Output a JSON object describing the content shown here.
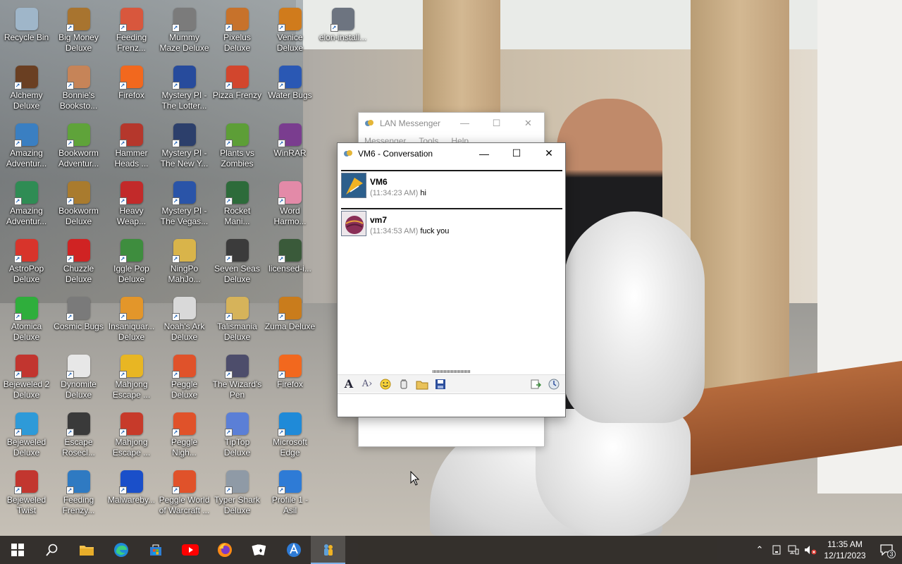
{
  "desktop": {
    "icons": [
      {
        "label": "Recycle Bin",
        "icon": "recycle-bin-icon",
        "color": "#9fb6c9"
      },
      {
        "label": "Big Money\nDeluxe",
        "icon": "money-bag-icon",
        "color": "#a8742f"
      },
      {
        "label": "Feeding\nFrenz...",
        "icon": "fish-icon",
        "color": "#d8573d"
      },
      {
        "label": "Mummy\nMaze Deluxe",
        "icon": "mummy-icon",
        "color": "#7b7b7b"
      },
      {
        "label": "Pixelus\nDeluxe",
        "icon": "pixelus-icon",
        "color": "#c7722b"
      },
      {
        "label": "Venice\nDeluxe",
        "icon": "venice-icon",
        "color": "#d07b1c"
      },
      {
        "label": "elon-install...",
        "icon": "installer-icon",
        "color": "#6d7480"
      },
      {
        "label": "Alchemy\nDeluxe",
        "icon": "alchemy-icon",
        "color": "#6a3f22"
      },
      {
        "label": "Bonnie's\nBooksto...",
        "icon": "bonnie-icon",
        "color": "#c68458"
      },
      {
        "label": "Firefox",
        "icon": "firefox-icon",
        "color": "#f2681e"
      },
      {
        "label": "Mystery PI -\nThe Lotter...",
        "icon": "mystery-pi-icon",
        "color": "#274b9c"
      },
      {
        "label": "Pizza Frenzy",
        "icon": "pizza-icon",
        "color": "#d2462d"
      },
      {
        "label": "Water Bugs",
        "icon": "water-bugs-icon",
        "color": "#2a58b4"
      },
      {
        "label": "Amazing\nAdventur...",
        "icon": "amazing-adventures-icon",
        "color": "#3a7fc2"
      },
      {
        "label": "Bookworm\nAdventur...",
        "icon": "bookworm-icon",
        "color": "#5fa33a"
      },
      {
        "label": "Hammer\nHeads ...",
        "icon": "hammer-heads-icon",
        "color": "#b5372c"
      },
      {
        "label": "Mystery PI -\nThe New Y...",
        "icon": "mystery-pi-ny-icon",
        "color": "#2c3f6b"
      },
      {
        "label": "Plants vs\nZombies",
        "icon": "plants-zombies-icon",
        "color": "#5d9e37"
      },
      {
        "label": "WinRAR",
        "icon": "winrar-icon",
        "color": "#7a3d8f"
      },
      {
        "label": "Amazing\nAdventur...",
        "icon": "amazing-adventures-2-icon",
        "color": "#2f8c54"
      },
      {
        "label": "Bookworm\nDeluxe",
        "icon": "bookworm-deluxe-icon",
        "color": "#a97b2e"
      },
      {
        "label": "Heavy\nWeap...",
        "icon": "heavy-weapon-icon",
        "color": "#c22a2a"
      },
      {
        "label": "Mystery PI -\nThe Vegas...",
        "icon": "mystery-pi-vegas-icon",
        "color": "#2a54a8"
      },
      {
        "label": "Rocket\nMani...",
        "icon": "rocket-mania-icon",
        "color": "#2d6b3a"
      },
      {
        "label": "Word\nHarmo...",
        "icon": "word-harmony-icon",
        "color": "#e38aa8"
      },
      {
        "label": "AstroPop\nDeluxe",
        "icon": "astropop-icon",
        "color": "#d8342b"
      },
      {
        "label": "Chuzzle\nDeluxe",
        "icon": "chuzzle-icon",
        "color": "#d02323"
      },
      {
        "label": "Iggle Pop\nDeluxe",
        "icon": "iggle-pop-icon",
        "color": "#3e8d3e"
      },
      {
        "label": "NingPo\nMahJo...",
        "icon": "ningpo-icon",
        "color": "#d9b44a"
      },
      {
        "label": "Seven Seas\nDeluxe",
        "icon": "seven-seas-icon",
        "color": "#3b3b3b"
      },
      {
        "label": "licensed-i...",
        "icon": "image-file-icon",
        "color": "#3a5a3a"
      },
      {
        "label": "Atomica\nDeluxe",
        "icon": "atomica-icon",
        "color": "#2fae3c"
      },
      {
        "label": "Cosmic Bugs",
        "icon": "cosmic-bugs-icon",
        "color": "#7a7a7a"
      },
      {
        "label": "Insaniquar...\nDeluxe",
        "icon": "insaniquarium-icon",
        "color": "#e3962a"
      },
      {
        "label": "Noah's Ark\nDeluxe",
        "icon": "noahs-ark-icon",
        "color": "#d9d9d9"
      },
      {
        "label": "Talismania\nDeluxe",
        "icon": "talismania-icon",
        "color": "#d6b35a"
      },
      {
        "label": "Zuma Deluxe",
        "icon": "zuma-icon",
        "color": "#c97c1c"
      },
      {
        "label": "Bejeweled 2\nDeluxe",
        "icon": "bejeweled-2-icon",
        "color": "#c2352f"
      },
      {
        "label": "Dynomite\nDeluxe",
        "icon": "dynomite-icon",
        "color": "#e7e7e7"
      },
      {
        "label": "Mahjong\nEscape ...",
        "icon": "mahjong-escape-icon",
        "color": "#e8b623"
      },
      {
        "label": "Peggle\nDeluxe",
        "icon": "peggle-icon",
        "color": "#e0522a"
      },
      {
        "label": "The Wizard's\nPen",
        "icon": "wizards-pen-icon",
        "color": "#4d4d6b"
      },
      {
        "label": "Firefox",
        "icon": "firefox-2-icon",
        "color": "#f2681e"
      },
      {
        "label": "Bejeweled\nDeluxe",
        "icon": "bejeweled-icon",
        "color": "#2e9ad8"
      },
      {
        "label": "Escape\nRosecl...",
        "icon": "escape-rosecliff-icon",
        "color": "#3a3a3a"
      },
      {
        "label": "Mahjong\nEscape ...",
        "icon": "mahjong-escape-2-icon",
        "color": "#c73a2a"
      },
      {
        "label": "Peggle\nNigh...",
        "icon": "peggle-nights-icon",
        "color": "#e0522a"
      },
      {
        "label": "TipTop\nDeluxe",
        "icon": "tiptop-icon",
        "color": "#5b7fd6"
      },
      {
        "label": "Microsoft\nEdge",
        "icon": "edge-icon",
        "color": "#1f8ad8"
      },
      {
        "label": "Bejeweled\nTwist",
        "icon": "bejeweled-twist-icon",
        "color": "#c2362f"
      },
      {
        "label": "Feeding\nFrenzy...",
        "icon": "feeding-frenzy-2-icon",
        "color": "#2f7ac2"
      },
      {
        "label": "Malwareby...",
        "icon": "malwarebytes-icon",
        "color": "#1a4fc9"
      },
      {
        "label": "Peggle World\nof Warcraft ...",
        "icon": "peggle-wow-icon",
        "color": "#e0522a"
      },
      {
        "label": "Typer Shark\nDeluxe",
        "icon": "typer-shark-icon",
        "color": "#8f9aa6"
      },
      {
        "label": "Profile 1 -\nAsil",
        "icon": "profile-icon",
        "color": "#2e7bd6"
      }
    ]
  },
  "lan_messenger": {
    "title": "LAN Messenger",
    "menu": [
      "Messenger",
      "Tools",
      "Help"
    ]
  },
  "conversation": {
    "title": "VM6 - Conversation",
    "messages": [
      {
        "sender": "VM6",
        "time": "(11:34:23 AM)",
        "text": "hi",
        "avatar_color": "#f0b324"
      },
      {
        "sender": "vm7",
        "time": "(11:34:53 AM)",
        "text": "fuck you",
        "avatar_color": "#8a2f57"
      }
    ],
    "toolbar": [
      "font-icon",
      "font-color-icon",
      "emoticon-icon",
      "nudge-icon",
      "send-file-icon",
      "save-icon",
      "history-icon",
      "transfers-icon"
    ]
  },
  "taskbar": {
    "apps": [
      "start-icon",
      "search-icon",
      "file-explorer-icon",
      "edge-icon",
      "store-icon",
      "youtube-icon",
      "firefox-icon",
      "solitaire-icon",
      "profile-icon",
      "lan-messenger-icon"
    ],
    "time": "11:35 AM",
    "date": "12/11/2023",
    "notification_count": "3"
  }
}
